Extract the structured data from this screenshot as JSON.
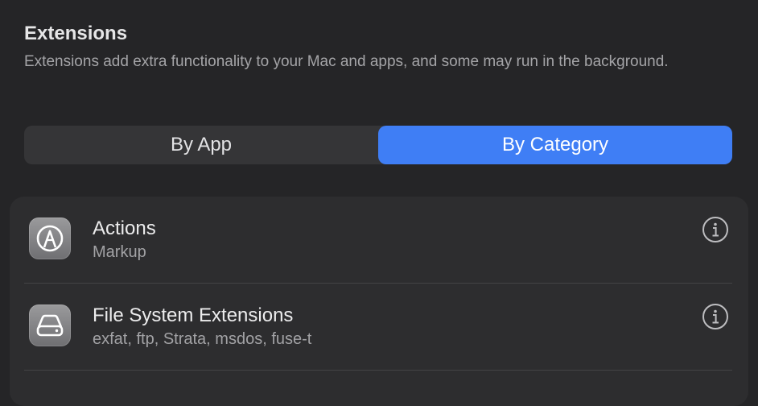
{
  "header": {
    "title": "Extensions",
    "subtitle": "Extensions add extra functionality to your Mac and apps, and some may run in the background."
  },
  "segmented": {
    "options": [
      "By App",
      "By Category"
    ],
    "selected": "By Category"
  },
  "rows": [
    {
      "title": "Actions",
      "subtitle": "Markup",
      "icon": "markup-pen-icon"
    },
    {
      "title": "File System Extensions",
      "subtitle": "exfat, ftp, Strata, msdos, fuse-t",
      "icon": "drive-icon"
    }
  ]
}
